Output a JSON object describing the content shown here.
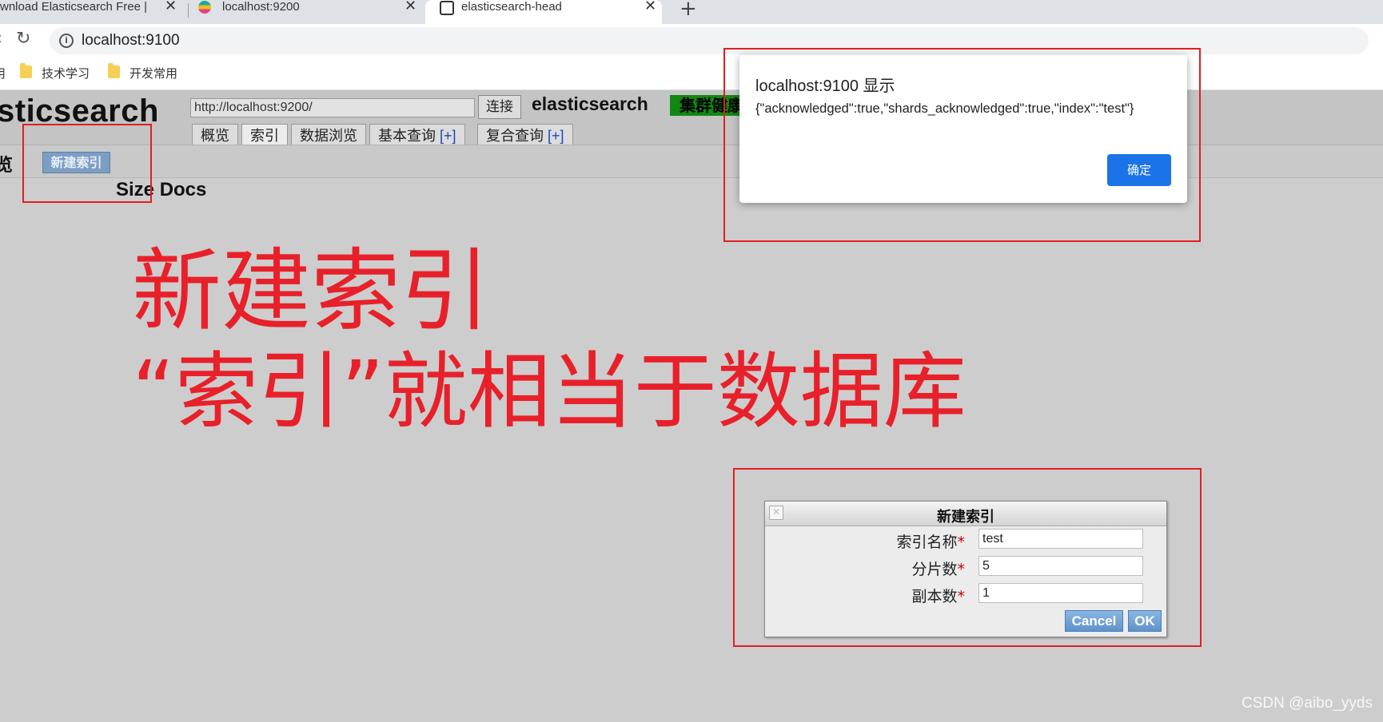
{
  "browser": {
    "tabs": [
      {
        "title": "wnload Elasticsearch Free |",
        "active": false
      },
      {
        "title": "localhost:9200",
        "active": false
      },
      {
        "title": "elasticsearch-head",
        "active": true
      }
    ],
    "new_tab": "+",
    "close_glyph": "✕",
    "address": "localhost:9100",
    "bookmarks": [
      {
        "label": "技术学习"
      },
      {
        "label": "开发常用"
      }
    ],
    "bookmark_cut": "用"
  },
  "es_head": {
    "logo": "sticsearch",
    "url_value": "http://localhost:9200/",
    "connect_label": "连接",
    "cluster_name": "elasticsearch",
    "health_label": "集群健康",
    "health_color": "#118811",
    "tabs": [
      {
        "label": "概览",
        "plus": ""
      },
      {
        "label": "索引",
        "plus": ""
      },
      {
        "label": "数据浏览",
        "plus": ""
      },
      {
        "label": "基本查询",
        "plus": "[+]"
      },
      {
        "label": "复合查询",
        "plus": "[+]"
      }
    ],
    "section_label": "览",
    "new_index_button": "新建索引",
    "columns": "Size Docs"
  },
  "annotation": {
    "line1": "新建索引",
    "line2": "“索引”就相当于数据库",
    "color": "#e8202a"
  },
  "alert": {
    "title": "localhost:9100 显示",
    "message": "{\"acknowledged\":true,\"shards_acknowledged\":true,\"index\":\"test\"}",
    "ok_label": "确定"
  },
  "create_dialog": {
    "title": "新建索引",
    "fields": [
      {
        "label": "索引名称",
        "required": "*",
        "value": "test"
      },
      {
        "label": "分片数",
        "required": "*",
        "value": "5"
      },
      {
        "label": "副本数",
        "required": "*",
        "value": "1"
      }
    ],
    "cancel_label": "Cancel",
    "ok_label": "OK"
  },
  "watermark": "CSDN @aibo_yyds"
}
